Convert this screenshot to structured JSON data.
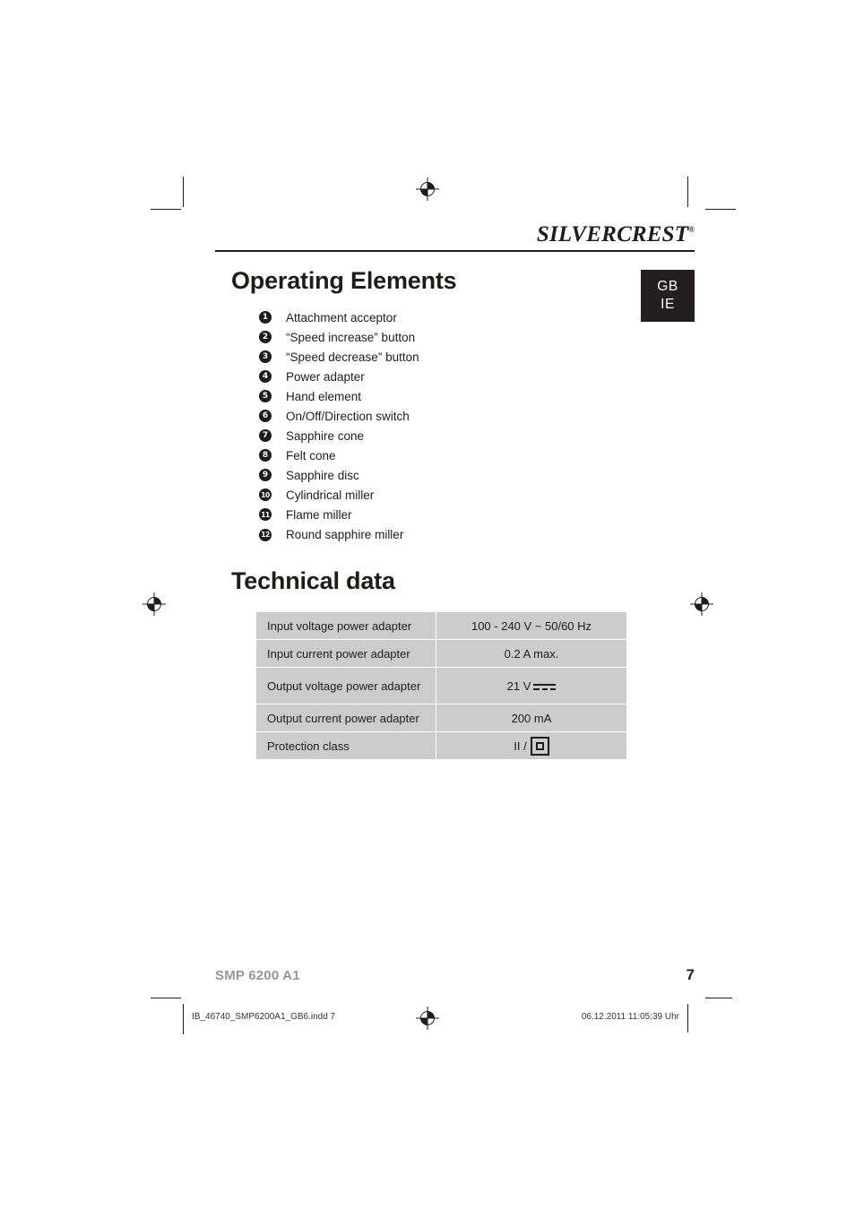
{
  "header": {
    "brand_part1": "SILVER",
    "brand_part2": "CREST",
    "registered_mark": "®",
    "language_badge_line1": "GB",
    "language_badge_line2": "IE"
  },
  "sections": {
    "operating_elements_title": "Operating Elements",
    "technical_data_title": "Technical data"
  },
  "operating_elements": [
    {
      "number": "1",
      "label": "Attachment acceptor"
    },
    {
      "number": "2",
      "label": "“Speed increase” button"
    },
    {
      "number": "3",
      "label": "“Speed decrease” button"
    },
    {
      "number": "4",
      "label": "Power adapter"
    },
    {
      "number": "5",
      "label": "Hand element"
    },
    {
      "number": "6",
      "label": "On/Off/Direction switch"
    },
    {
      "number": "7",
      "label": "Sapphire cone"
    },
    {
      "number": "8",
      "label": "Felt cone"
    },
    {
      "number": "9",
      "label": "Sapphire disc"
    },
    {
      "number": "10",
      "label": "Cylindrical miller"
    },
    {
      "number": "11",
      "label": "Flame miller"
    },
    {
      "number": "12",
      "label": "Round sapphire miller"
    }
  ],
  "technical_data": [
    {
      "key": "Input voltage power adapter",
      "value": "100 - 240 V ~ 50/60 Hz",
      "symbol": "none"
    },
    {
      "key": "Input current power adapter",
      "value": "0.2 A max.",
      "symbol": "none"
    },
    {
      "key": "Output voltage power adapter",
      "value": "21 V",
      "symbol": "dc-voltage-icon"
    },
    {
      "key": "Output current power adapter",
      "value": "200 mA",
      "symbol": "none"
    },
    {
      "key": "Protection class",
      "value": "II /",
      "symbol": "class-two-icon"
    }
  ],
  "footer": {
    "model": "SMP 6200 A1",
    "page_number": "7",
    "print_file": "IB_46740_SMP6200A1_GB6.indd   7",
    "print_date": "06.12.2011   11:05:39 Uhr"
  },
  "colors": {
    "ink": "#1d1d1b",
    "badge_background": "#231f20",
    "table_cell_background": "#cccccc",
    "footer_model_gray": "#939598"
  }
}
